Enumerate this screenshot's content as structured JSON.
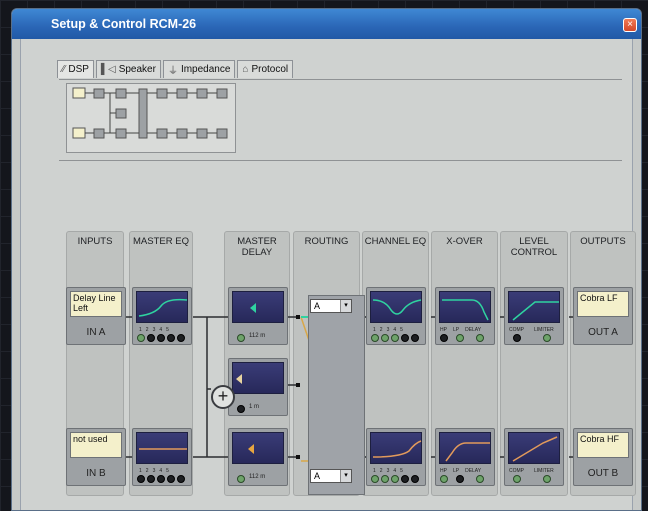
{
  "window": {
    "title": "Setup & Control RCM-26",
    "close_glyph": "×"
  },
  "tabs": [
    {
      "label": "DSP",
      "icon": "dsp-icon"
    },
    {
      "label": "Speaker",
      "icon": "speaker-icon"
    },
    {
      "label": "Impedance",
      "icon": "impedance-icon"
    },
    {
      "label": "Protocol",
      "icon": "protocol-icon"
    }
  ],
  "columns": {
    "inputs": "INPUTS",
    "master_eq": "MASTER EQ",
    "master_delay": "MASTER DELAY",
    "routing": "ROUTING",
    "channel_eq": "CHANNEL EQ",
    "xover": "X-OVER",
    "level_control": "LEVEL CONTROL",
    "outputs": "OUTPUTS"
  },
  "inputs": [
    {
      "label": "Delay Line Left",
      "name": "IN A"
    },
    {
      "label": "not used",
      "name": "IN B"
    }
  ],
  "eq_bands": [
    "1",
    "2",
    "3",
    "4",
    "5"
  ],
  "master_delay": {
    "delay_a": "112 m",
    "delay_sum": "1 m",
    "delay_b": "112 m"
  },
  "routing": {
    "select_a": "A",
    "select_b": "A",
    "arrow": "▾"
  },
  "xover_labels": [
    "HP",
    "LP",
    "DELAY"
  ],
  "level_labels": [
    "COMP",
    "LIMITER"
  ],
  "outputs": [
    {
      "label": "Cobra LF",
      "name": "OUT A"
    },
    {
      "label": "Cobra HF",
      "name": "OUT B"
    }
  ],
  "sum_symbol": "+",
  "colors": {
    "title_bar": "#2a66b6",
    "screen": "#2c2e63",
    "trace_green": "#2fd3a0",
    "trace_orange": "#e29a5b",
    "route_line": "#d9a747"
  }
}
